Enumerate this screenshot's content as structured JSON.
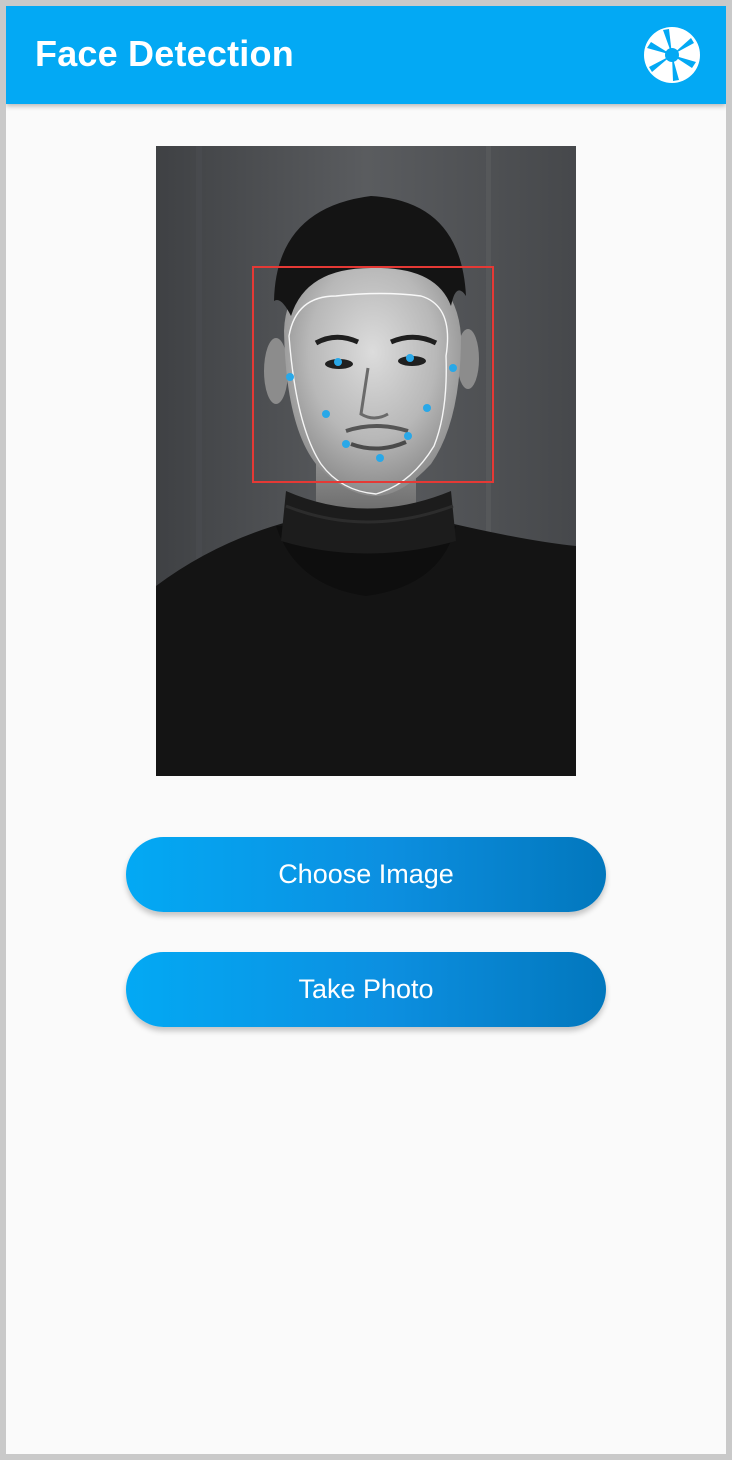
{
  "app_bar": {
    "title": "Face Detection",
    "icon": "camera-shutter-icon",
    "background": "#03a9f4"
  },
  "preview": {
    "face_box_color": "#e53935",
    "landmark_color": "#29a8e8",
    "contour_color": "#ffffff"
  },
  "buttons": {
    "choose_image_label": "Choose Image",
    "take_photo_label": "Take Photo",
    "gradient_start": "#03a9f4",
    "gradient_end": "#0277bd"
  }
}
